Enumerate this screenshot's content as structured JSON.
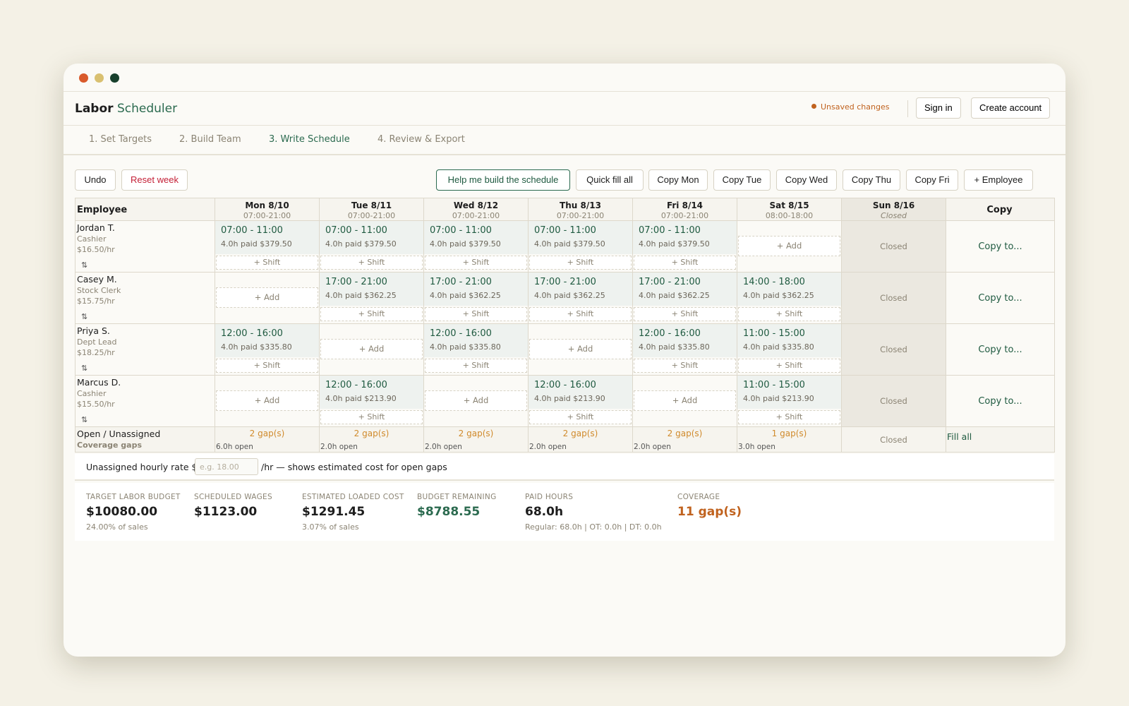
{
  "brand": {
    "bold": "Labor",
    "rest": "Scheduler"
  },
  "header": {
    "unsaved": "Unsaved changes",
    "signin": "Sign in",
    "create": "Create account"
  },
  "tabs": [
    "1. Set Targets",
    "2. Build Team",
    "3. Write Schedule",
    "4. Review & Export"
  ],
  "toolbar": {
    "undo": "Undo",
    "reset": "Reset week",
    "help": "Help me build the schedule",
    "quick": "Quick fill all",
    "copy_mon": "Copy Mon",
    "copy_tue": "Copy Tue",
    "copy_wed": "Copy Wed",
    "copy_thu": "Copy Thu",
    "copy_fri": "Copy Fri",
    "add_employee": "+ Employee"
  },
  "grid": {
    "employee_header": "Employee",
    "copy_header": "Copy",
    "days": [
      {
        "label": "Mon 8/10",
        "hours": "07:00-21:00"
      },
      {
        "label": "Tue 8/11",
        "hours": "07:00-21:00"
      },
      {
        "label": "Wed 8/12",
        "hours": "07:00-21:00"
      },
      {
        "label": "Thu 8/13",
        "hours": "07:00-21:00"
      },
      {
        "label": "Fri 8/14",
        "hours": "07:00-21:00"
      },
      {
        "label": "Sat 8/15",
        "hours": "08:00-18:00"
      },
      {
        "label": "Sun 8/16",
        "hours": "Closed"
      }
    ],
    "add_shift": "+ Shift",
    "add": "+ Add",
    "closed": "Closed",
    "copy_to": "Copy to...",
    "drag": "⇅",
    "employees": [
      {
        "name": "Jordan T.",
        "role": "Cashier",
        "rate": "$16.50/hr",
        "shifts": [
          {
            "time": "07:00 - 11:00",
            "cost": "4.0h paid $379.50"
          },
          {
            "time": "07:00 - 11:00",
            "cost": "4.0h paid $379.50"
          },
          {
            "time": "07:00 - 11:00",
            "cost": "4.0h paid $379.50"
          },
          {
            "time": "07:00 - 11:00",
            "cost": "4.0h paid $379.50"
          },
          {
            "time": "07:00 - 11:00",
            "cost": "4.0h paid $379.50"
          },
          null
        ]
      },
      {
        "name": "Casey M.",
        "role": "Stock Clerk",
        "rate": "$15.75/hr",
        "shifts": [
          null,
          {
            "time": "17:00 - 21:00",
            "cost": "4.0h paid $362.25"
          },
          {
            "time": "17:00 - 21:00",
            "cost": "4.0h paid $362.25"
          },
          {
            "time": "17:00 - 21:00",
            "cost": "4.0h paid $362.25"
          },
          {
            "time": "17:00 - 21:00",
            "cost": "4.0h paid $362.25"
          },
          {
            "time": "14:00 - 18:00",
            "cost": "4.0h paid $362.25"
          }
        ]
      },
      {
        "name": "Priya S.",
        "role": "Dept Lead",
        "rate": "$18.25/hr",
        "shifts": [
          {
            "time": "12:00 - 16:00",
            "cost": "4.0h paid $335.80"
          },
          null,
          {
            "time": "12:00 - 16:00",
            "cost": "4.0h paid $335.80"
          },
          null,
          {
            "time": "12:00 - 16:00",
            "cost": "4.0h paid $335.80"
          },
          {
            "time": "11:00 - 15:00",
            "cost": "4.0h paid $335.80"
          }
        ]
      },
      {
        "name": "Marcus D.",
        "role": "Cashier",
        "rate": "$15.50/hr",
        "shifts": [
          null,
          {
            "time": "12:00 - 16:00",
            "cost": "4.0h paid $213.90"
          },
          null,
          {
            "time": "12:00 - 16:00",
            "cost": "4.0h paid $213.90"
          },
          null,
          {
            "time": "11:00 - 15:00",
            "cost": "4.0h paid $213.90"
          }
        ]
      }
    ],
    "open": {
      "name": "Open / Unassigned",
      "sub": "Coverage gaps",
      "fill_all": "Fill all",
      "gaps": [
        {
          "gap": "2 gap(s)",
          "open": "6.0h open"
        },
        {
          "gap": "2 gap(s)",
          "open": "2.0h open"
        },
        {
          "gap": "2 gap(s)",
          "open": "2.0h open"
        },
        {
          "gap": "2 gap(s)",
          "open": "2.0h open"
        },
        {
          "gap": "2 gap(s)",
          "open": "2.0h open"
        },
        {
          "gap": "1 gap(s)",
          "open": "3.0h open"
        }
      ]
    }
  },
  "rate": {
    "label": "Unassigned hourly rate $",
    "placeholder": "e.g. 18.00",
    "suffix": "/hr — shows estimated cost for open gaps"
  },
  "summary": {
    "budget": {
      "label": "TARGET LABOR BUDGET",
      "value": "$10080.00",
      "sub": "24.00% of sales"
    },
    "wages": {
      "label": "SCHEDULED WAGES",
      "value": "$1123.00"
    },
    "loaded": {
      "label": "ESTIMATED LOADED COST",
      "value": "$1291.45",
      "sub": "3.07% of sales"
    },
    "remaining": {
      "label": "BUDGET REMAINING",
      "value": "$8788.55"
    },
    "hours": {
      "label": "PAID HOURS",
      "value": "68.0h",
      "sub": "Regular: 68.0h | OT: 0.0h | DT: 0.0h"
    },
    "coverage": {
      "label": "COVERAGE",
      "value": "11 gap(s)"
    }
  },
  "colors": {
    "accent": "#2b6a4f",
    "warning": "#c0621e",
    "gap": "#d08a2b",
    "danger": "#c41f36"
  }
}
